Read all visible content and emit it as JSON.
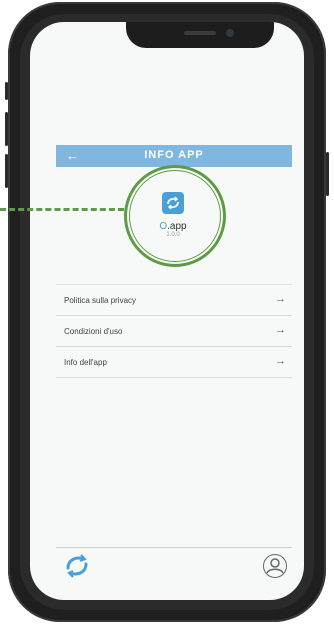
{
  "header": {
    "back_icon": "arrow-left-icon",
    "title": "INFO APP"
  },
  "app": {
    "icon": "app-logo-icon",
    "name_prefix": "O",
    "name_suffix": ".app",
    "version": "1.0.0"
  },
  "menu": {
    "items": [
      {
        "label": "Politica sulla privacy",
        "icon": "arrow-right-icon"
      },
      {
        "label": "Condizioni d'uso",
        "icon": "arrow-right-icon"
      },
      {
        "label": "Info dell'app",
        "icon": "arrow-right-icon"
      }
    ]
  },
  "footer": {
    "logo_icon": "app-logo-icon",
    "profile_icon": "profile-icon"
  },
  "colors": {
    "accent": "#7fb7de",
    "highlight": "#5e9b46",
    "icon_blue": "#4a9fd6"
  }
}
